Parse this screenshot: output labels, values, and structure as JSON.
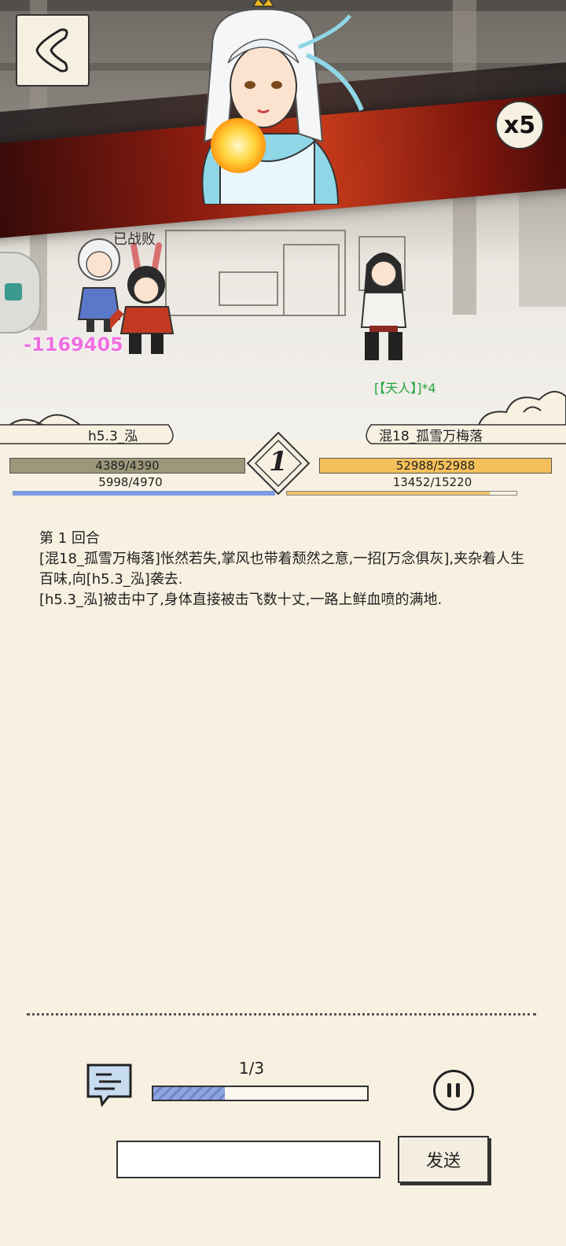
{
  "scene": {
    "speed_label": "x5",
    "defeated_label": "已战败",
    "damage_number": "-1169405",
    "buff_label": "[【天人】]*4"
  },
  "battle": {
    "left_name": "h5.3_泓",
    "right_name": "混18_孤雪万梅落",
    "round_number": "1",
    "left_hp": "4389/4390",
    "left_mp": "5998/4970",
    "right_hp": "52988/52988",
    "right_mp": "13452/15220",
    "left_hp_fraction": 1.0,
    "right_hp_fraction": 1.0,
    "left_mp_fraction": 1.0,
    "right_mp_fraction": 0.884
  },
  "log": {
    "lines": [
      "第 1 回合",
      "[混18_孤雪万梅落]怅然若失,掌风也带着颓然之意,一招[万念俱灰],夹杂着人生百味,向[h5.3_泓]袭去.",
      "[h5.3_泓]被击中了,身体直接被击飞数十丈,一路上鲜血喷的满地."
    ]
  },
  "controls": {
    "progress_label": "1/3",
    "progress_fraction": 0.333,
    "input_value": "",
    "send_label": "发送"
  },
  "colors": {
    "background": "#f8f1e2",
    "hp_left": "#9c977a",
    "hp_right": "#f5c05a",
    "mp_left": "#7f9be0",
    "mp_right": "#f0c26a",
    "damage": "#f070e0",
    "buff": "#22a43a"
  },
  "icons": [
    "back-arrow-icon",
    "chat-bubble-icon",
    "pause-icon"
  ]
}
